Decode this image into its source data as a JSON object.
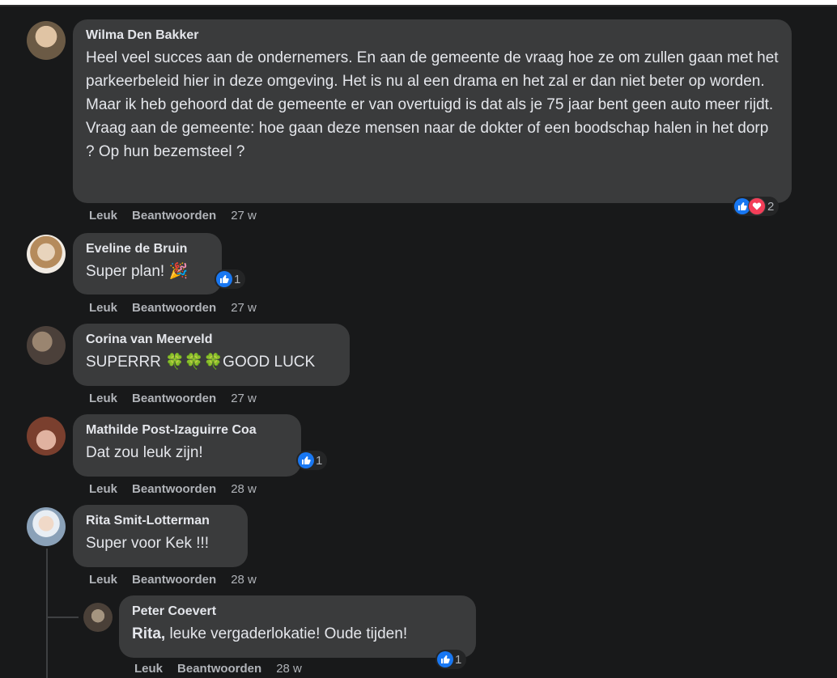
{
  "comments": [
    {
      "name": "Wilma Den Bakker",
      "text": "Heel veel succes aan de ondernemers. En aan de gemeente de vraag hoe ze om zullen gaan met het parkeerbeleid hier in deze omgeving. Het is nu al een drama en het zal er dan niet beter op worden. Maar ik heb gehoord dat de gemeente er van overtuigd is dat als je 75 jaar bent geen auto meer rijdt. Vraag aan de gemeente: hoe gaan deze mensen naar de dokter of een boodschap halen in het dorp ? Op hun bezemsteel ?",
      "like_label": "Leuk",
      "reply_label": "Beantwoorden",
      "time": "27 w",
      "reaction_count": "2",
      "avatar_colors": [
        "#c9a98a",
        "#6b5a45"
      ]
    },
    {
      "name": "Eveline de Bruin",
      "text": "Super plan!",
      "emoji": "🎉",
      "like_label": "Leuk",
      "reply_label": "Beantwoorden",
      "time": "27 w",
      "reaction_count": "1",
      "avatar_colors": [
        "#d8c6b0",
        "#8b6d4f"
      ]
    },
    {
      "name": "Corina van Meerveld",
      "text_before": "SUPERRR",
      "emoji": "🍀🍀🍀",
      "text_after": "GOOD LUCK",
      "like_label": "Leuk",
      "reply_label": "Beantwoorden",
      "time": "27 w",
      "avatar_colors": [
        "#7a6a5a",
        "#3a3330"
      ]
    },
    {
      "name": "Mathilde Post-Izaguirre Coa",
      "text": "Dat zou leuk zijn!",
      "like_label": "Leuk",
      "reply_label": "Beantwoorden",
      "time": "28 w",
      "reaction_count": "1",
      "avatar_colors": [
        "#c98f7a",
        "#6e3d2f"
      ]
    },
    {
      "name": "Rita Smit-Lotterman",
      "text": "Super voor Kek !!!",
      "like_label": "Leuk",
      "reply_label": "Beantwoorden",
      "time": "28 w",
      "avatar_colors": [
        "#dfe7ee",
        "#7d8fa3"
      ]
    },
    {
      "name": "Peter Coevert",
      "mention": "Rita,",
      "text": " leuke vergaderlokatie! Oude tijden!",
      "like_label": "Leuk",
      "reply_label": "Beantwoorden",
      "time": "28 w",
      "reaction_count": "1",
      "avatar_colors": [
        "#8a7c6a",
        "#4a4038"
      ]
    }
  ],
  "colors": {
    "background": "#18191a",
    "bubble": "#3a3b3c",
    "like_blue": "#1877f2",
    "love_red": "#f33e58",
    "meta_text": "#b0b3b8"
  },
  "icons": [
    "like-icon",
    "love-icon",
    "avatar"
  ]
}
